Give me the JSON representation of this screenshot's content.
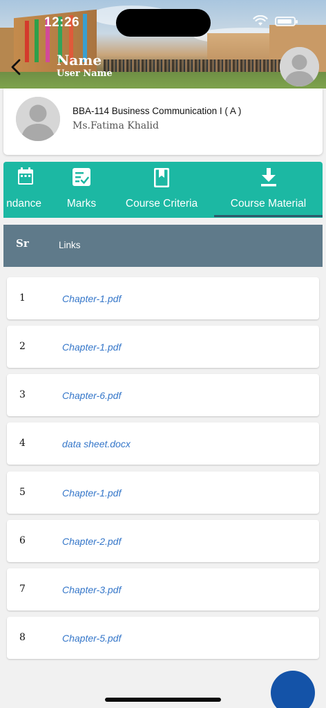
{
  "status_bar": {
    "time": "12:26"
  },
  "header": {
    "title": "Name",
    "subtitle": "User Name"
  },
  "course": {
    "title": "BBA-114 Business Communication I ( A )",
    "teacher": "Ms.Fatima Khalid"
  },
  "tabs": [
    {
      "label": "ndance",
      "icon": "calendar-icon"
    },
    {
      "label": "Marks",
      "icon": "checklist-icon"
    },
    {
      "label": "Course Criteria",
      "icon": "bookmark-book-icon"
    },
    {
      "label": "Course Material",
      "icon": "download-icon",
      "active": true
    }
  ],
  "table": {
    "headers": {
      "sr": "Sr",
      "links": "Links"
    },
    "rows": [
      {
        "sr": "1",
        "link": "Chapter-1.pdf"
      },
      {
        "sr": "2",
        "link": "Chapter-1.pdf"
      },
      {
        "sr": "3",
        "link": "Chapter-6.pdf"
      },
      {
        "sr": "4",
        "link": "data sheet.docx"
      },
      {
        "sr": "5",
        "link": "Chapter-1.pdf"
      },
      {
        "sr": "6",
        "link": "Chapter-2.pdf"
      },
      {
        "sr": "7",
        "link": "Chapter-3.pdf"
      },
      {
        "sr": "8",
        "link": "Chapter-5.pdf"
      }
    ]
  },
  "colors": {
    "tab_bar": "#1cb8a3",
    "table_header": "#5f7a8a",
    "link": "#3476c9",
    "fab": "#1453a8"
  }
}
